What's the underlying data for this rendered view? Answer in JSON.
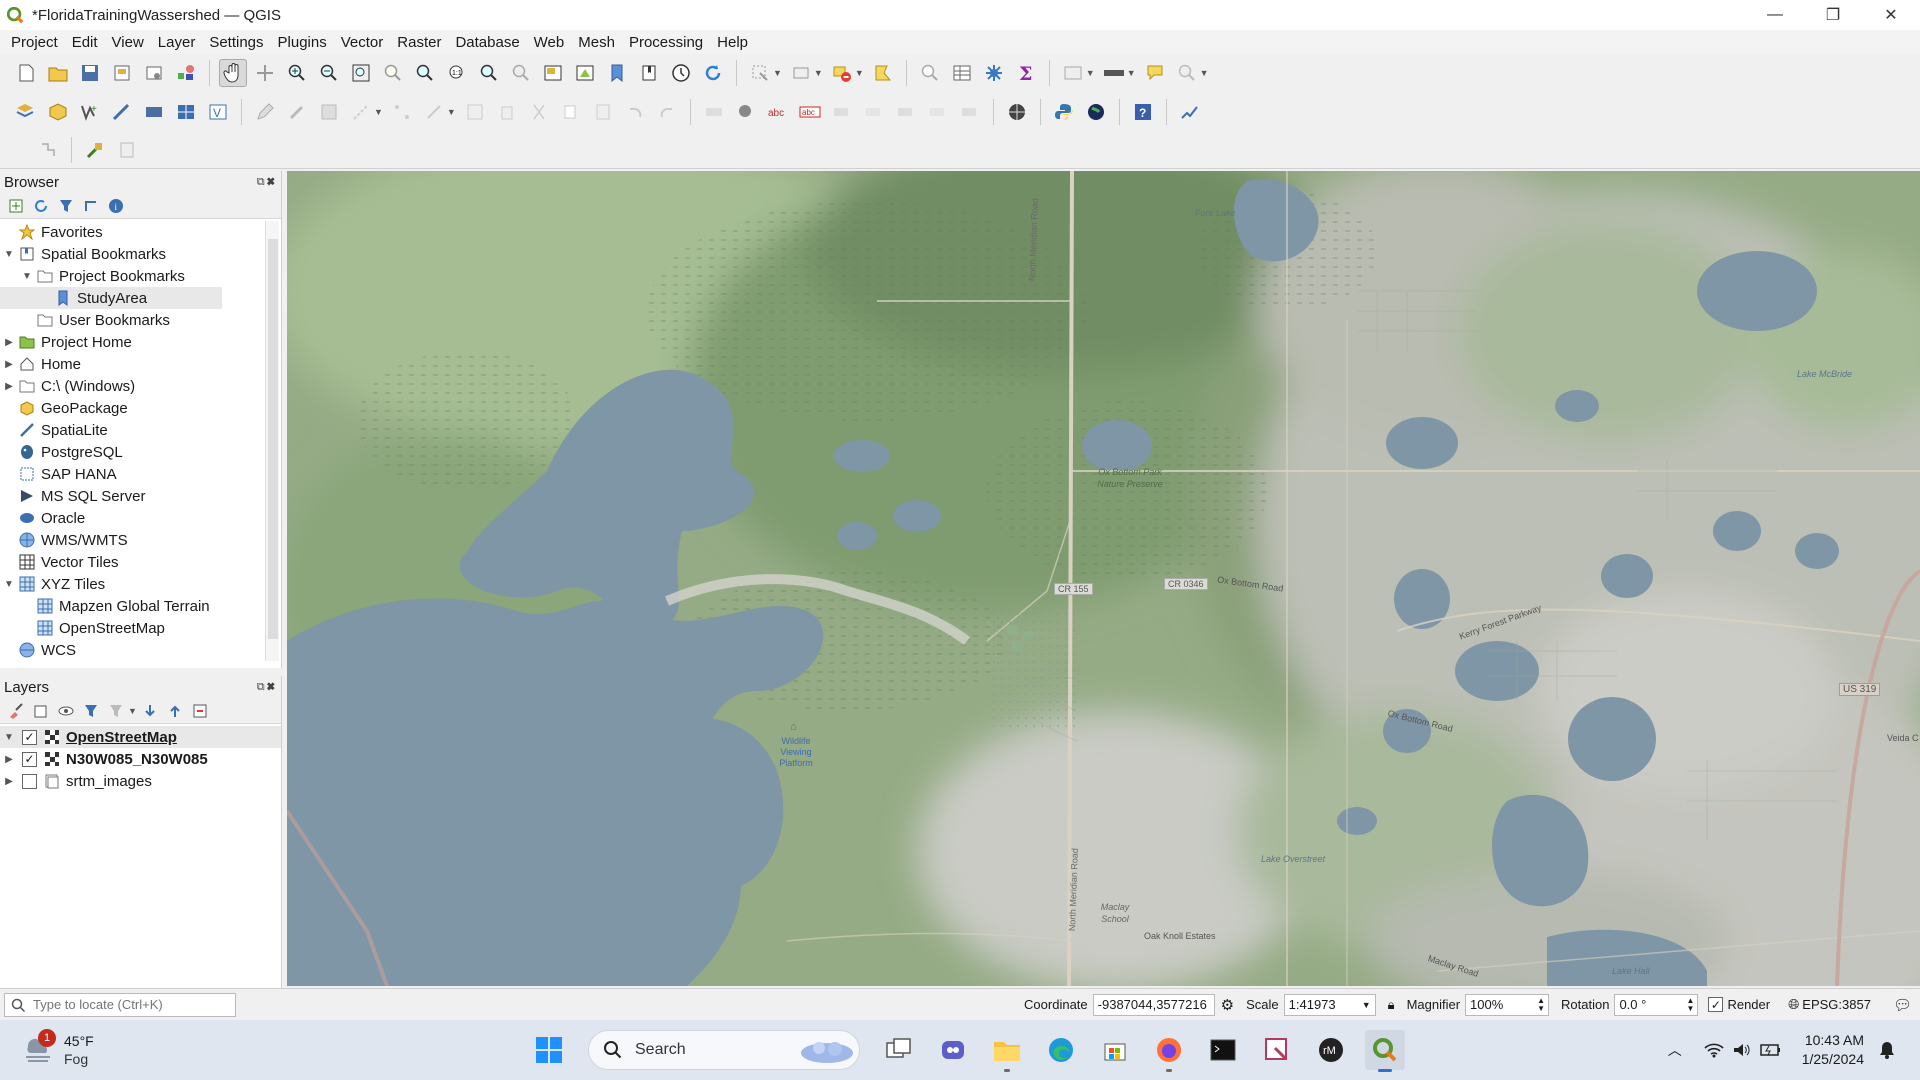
{
  "window": {
    "title": "*FloridaTrainingWassershed — QGIS",
    "minimize": "—",
    "restore": "❐",
    "close": "✕"
  },
  "menu": [
    "Project",
    "Edit",
    "View",
    "Layer",
    "Settings",
    "Plugins",
    "Vector",
    "Raster",
    "Database",
    "Web",
    "Mesh",
    "Processing",
    "Help"
  ],
  "browser": {
    "title": "Browser",
    "items": [
      {
        "label": "Favorites",
        "icon": "star-icon",
        "indent": 0,
        "arrow": ""
      },
      {
        "label": "Spatial Bookmarks",
        "icon": "bookmarks-icon",
        "indent": 0,
        "arrow": "▼"
      },
      {
        "label": "Project Bookmarks",
        "icon": "folder-icon",
        "indent": 1,
        "arrow": "▼"
      },
      {
        "label": "StudyArea",
        "icon": "bookmark-icon",
        "indent": 2,
        "arrow": ""
      },
      {
        "label": "User Bookmarks",
        "icon": "folder-icon",
        "indent": 1,
        "arrow": ""
      },
      {
        "label": "Project Home",
        "icon": "project-home-icon",
        "indent": 0,
        "arrow": "▶"
      },
      {
        "label": "Home",
        "icon": "home-icon",
        "indent": 0,
        "arrow": "▶"
      },
      {
        "label": "C:\\ (Windows)",
        "icon": "drive-icon",
        "indent": 0,
        "arrow": "▶"
      },
      {
        "label": "GeoPackage",
        "icon": "geopackage-icon",
        "indent": 0,
        "arrow": ""
      },
      {
        "label": "SpatiaLite",
        "icon": "spatialite-icon",
        "indent": 0,
        "arrow": ""
      },
      {
        "label": "PostgreSQL",
        "icon": "postgresql-icon",
        "indent": 0,
        "arrow": ""
      },
      {
        "label": "SAP HANA",
        "icon": "sap-hana-icon",
        "indent": 0,
        "arrow": ""
      },
      {
        "label": "MS SQL Server",
        "icon": "mssql-icon",
        "indent": 0,
        "arrow": ""
      },
      {
        "label": "Oracle",
        "icon": "oracle-icon",
        "indent": 0,
        "arrow": ""
      },
      {
        "label": "WMS/WMTS",
        "icon": "wms-icon",
        "indent": 0,
        "arrow": ""
      },
      {
        "label": "Vector Tiles",
        "icon": "vector-tiles-icon",
        "indent": 0,
        "arrow": ""
      },
      {
        "label": "XYZ Tiles",
        "icon": "xyz-tiles-icon",
        "indent": 0,
        "arrow": "▼"
      },
      {
        "label": "Mapzen Global Terrain",
        "icon": "tile-icon",
        "indent": 1,
        "arrow": ""
      },
      {
        "label": "OpenStreetMap",
        "icon": "tile-icon",
        "indent": 1,
        "arrow": ""
      },
      {
        "label": "WCS",
        "icon": "wcs-icon",
        "indent": 0,
        "arrow": ""
      }
    ]
  },
  "layers": {
    "title": "Layers",
    "items": [
      {
        "label": "OpenStreetMap",
        "checked": true,
        "style": "bold under",
        "arrow": "▼",
        "icon": "raster-tile-icon"
      },
      {
        "label": "N30W085_N30W085",
        "checked": true,
        "style": "bold",
        "arrow": "▶",
        "icon": "raster-tile-icon"
      },
      {
        "label": "srtm_images",
        "checked": false,
        "style": "",
        "arrow": "▶",
        "icon": "group-icon"
      }
    ]
  },
  "map": {
    "labels": {
      "fore_lake": "Fore Lake",
      "north_meridian_road_top": "North Meridian Road",
      "ox_bottom_preserve": "Ox Bottom Park Nature Preserve",
      "lake_mcbride": "Lake McBride",
      "cr155": "CR 155",
      "cr0346": "CR 0346",
      "ox_bottom_road": "Ox Bottom Road",
      "kerry_forest": "Kerry Forest Parkway",
      "us319": "US 319",
      "ox_bottom_road_2": "Ox Bottom Road",
      "veida": "Veida C",
      "wildlife_platform": "Wildlife Viewing Platform",
      "north_meridian_road_bottom": "North Meridian Road",
      "maclay_school": "Maclay School",
      "oak_knoll": "Oak Knoll Estates",
      "lake_overstreet": "Lake Overstreet",
      "maclay_road": "Maclay Road",
      "lake_hall": "Lake Hall"
    }
  },
  "status": {
    "locator_placeholder": "Type to locate (Ctrl+K)",
    "coordinate_label": "Coordinate",
    "coordinate_value": "-9387044,3577216",
    "scale_label": "Scale",
    "scale_value": "1:41973",
    "magnifier_label": "Magnifier",
    "magnifier_value": "100%",
    "rotation_label": "Rotation",
    "rotation_value": "0.0 °",
    "render_label": "Render",
    "crs": "EPSG:3857"
  },
  "taskbar": {
    "weather_temp": "45°F",
    "weather_desc": "Fog",
    "weather_badge": "1",
    "search_label": "Search",
    "time": "10:43 AM",
    "date": "1/25/2024"
  },
  "colors": {
    "water": "#7e96a5",
    "forest": "#88a477",
    "urban": "#c9cbc4",
    "accent": "#1e7b1e"
  }
}
